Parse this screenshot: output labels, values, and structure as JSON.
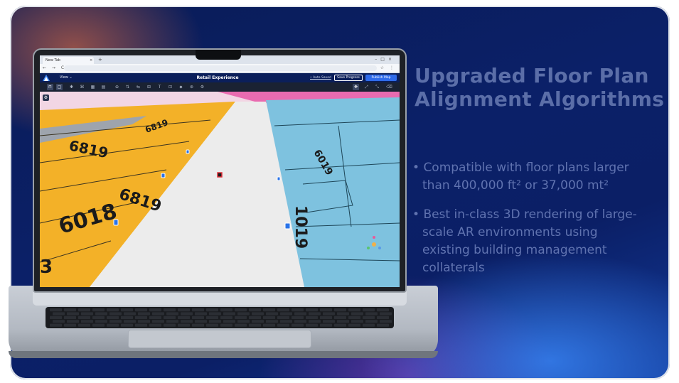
{
  "slide": {
    "headline": "Upgraded Floor Plan Alignment Algorithms",
    "bullets": [
      "Compatible with floor plans larger than 400,000 ft² or 37,000 mt²",
      "Best in-class 3D rendering of large-scale AR environments using existing building management collaterals"
    ]
  },
  "browser": {
    "tab_title": "New Tab",
    "tab_close": "×",
    "new_tab": "+",
    "window_controls": "–□×",
    "nav_buttons": "← → C",
    "url": "",
    "address_right": "☆ ⋮"
  },
  "app": {
    "view_menu": "View ⌄",
    "title": "Retail Experience",
    "autosave_label": "• Auto Saved",
    "save_progress_label": "Save Progress",
    "publish_map_label": "Publish Map",
    "toolbar_icons": [
      "⊓",
      "▢",
      "✱",
      "⌘",
      "▦",
      "▤",
      "⊕",
      "⇅",
      "⇆",
      "⊞",
      "T",
      "⊡",
      "⬥",
      "⊛",
      "⚙"
    ],
    "right_tools": [
      "✥",
      "⤢",
      "⤡",
      "⌫"
    ],
    "side_button": "⚙"
  },
  "map": {
    "labels": [
      "6819",
      "6819",
      "6819",
      "6018",
      "1019",
      "6019",
      "3"
    ],
    "colors": {
      "yellow_zone": "#f3b128",
      "blue_zone": "#7ec2df",
      "aisle": "#ececec",
      "pink_zone": "#e96bb0",
      "grey_strip": "#9ea4ad"
    }
  }
}
